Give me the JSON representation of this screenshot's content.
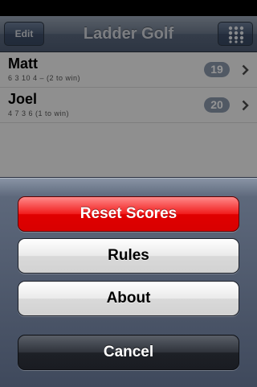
{
  "nav": {
    "title": "Ladder Golf",
    "edit_label": "Edit",
    "grid_icon": "grid-dots-icon"
  },
  "players": [
    {
      "name": "Matt",
      "detail": "6  3  10  4  –  (2 to win)",
      "score": "19"
    },
    {
      "name": "Joel",
      "detail": "4  7  3  6  (1 to win)",
      "score": "20"
    }
  ],
  "action_sheet": {
    "reset_label": "Reset Scores",
    "rules_label": "Rules",
    "about_label": "About",
    "cancel_label": "Cancel"
  },
  "colors": {
    "destructive": "#e00000",
    "nav_bar": "#6e7b8e",
    "badge": "#8c99ad"
  }
}
